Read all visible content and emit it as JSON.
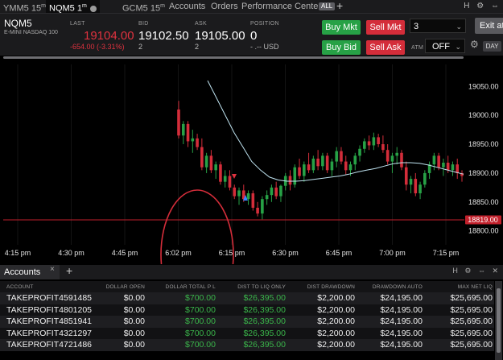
{
  "tabs": [
    {
      "label": "YMM5 15",
      "sup": "m",
      "active": false
    },
    {
      "label": "NQM5 1",
      "sup": "m",
      "active": true
    },
    {
      "label": "GCM5 15",
      "sup": "m",
      "active": false
    },
    {
      "label": "Accounts",
      "sup": "",
      "active": false
    },
    {
      "label": "Orders",
      "sup": "",
      "active": false
    },
    {
      "label": "Performance Center",
      "sup": "",
      "active": false
    }
  ],
  "all_badge": "ALL",
  "add_tab": "+",
  "window_icons": "H ⚙ ⇔",
  "quote": {
    "symbol": "NQM5",
    "description": "E-MINI NASDAQ 100",
    "last_label": "LAST",
    "last": "19104.00",
    "change": "-654.00 (-3.31%)",
    "bid_label": "BID",
    "bid": "19102.50",
    "bid_size": "2",
    "ask_label": "ASK",
    "ask": "19105.00",
    "ask_size": "2",
    "position_label": "POSITION",
    "position": "0",
    "position_sub": "- .-- USD"
  },
  "buttons": {
    "buy_mkt": "Buy Mkt",
    "sell_mkt": "Sell Mkt",
    "buy_bid": "Buy Bid",
    "sell_ask": "Sell Ask",
    "exit": "Exit at",
    "day": "DAY"
  },
  "quantity": "3",
  "atm_label": "ATM",
  "atm_value": "OFF",
  "colors": {
    "up": "#27a146",
    "down": "#d42d3a",
    "ma": "#bfe3f0",
    "price_line": "#c2202b",
    "highlight": "#d42d3a"
  },
  "chart_data": {
    "type": "candlestick",
    "y_ticks": [
      "19050.00",
      "19000.00",
      "18950.00",
      "18900.00",
      "18850.00",
      "18800.00"
    ],
    "ylim": [
      18787,
      19088
    ],
    "x_ticks": [
      "4:15 pm",
      "4:30 pm",
      "4:45 pm",
      "6:02 pm",
      "6:15 pm",
      "6:30 pm",
      "6:45 pm",
      "7:00 pm",
      "7:15 pm"
    ],
    "price_line": {
      "value": 18819.0,
      "label": "18819.00"
    },
    "candles": [
      [
        19010,
        19025,
        18960,
        18965
      ],
      [
        18965,
        18990,
        18950,
        18985
      ],
      [
        18985,
        18990,
        18945,
        18955
      ],
      [
        18955,
        18975,
        18935,
        18960
      ],
      [
        18960,
        18968,
        18940,
        18945
      ],
      [
        18945,
        18960,
        18905,
        18910
      ],
      [
        18910,
        18935,
        18900,
        18930
      ],
      [
        18930,
        18940,
        18900,
        18905
      ],
      [
        18905,
        18920,
        18890,
        18915
      ],
      [
        18915,
        18920,
        18880,
        18885
      ],
      [
        18885,
        18905,
        18875,
        18895
      ],
      [
        18895,
        18905,
        18870,
        18875
      ],
      [
        18875,
        18880,
        18855,
        18860
      ],
      [
        18860,
        18875,
        18845,
        18870
      ],
      [
        18870,
        18880,
        18850,
        18855
      ],
      [
        18855,
        18870,
        18845,
        18865
      ],
      [
        18865,
        18870,
        18835,
        18840
      ],
      [
        18840,
        18850,
        18825,
        18830
      ],
      [
        18830,
        18860,
        18820,
        18855
      ],
      [
        18855,
        18870,
        18845,
        18862
      ],
      [
        18862,
        18880,
        18850,
        18875
      ],
      [
        18875,
        18885,
        18855,
        18860
      ],
      [
        18860,
        18880,
        18850,
        18878
      ],
      [
        18878,
        18900,
        18870,
        18895
      ],
      [
        18895,
        18905,
        18870,
        18880
      ],
      [
        18880,
        18915,
        18875,
        18910
      ],
      [
        18910,
        18925,
        18890,
        18895
      ],
      [
        18895,
        18920,
        18885,
        18915
      ],
      [
        18915,
        18935,
        18900,
        18905
      ],
      [
        18905,
        18930,
        18900,
        18925
      ],
      [
        18925,
        18940,
        18905,
        18912
      ],
      [
        18912,
        18935,
        18905,
        18930
      ],
      [
        18930,
        18935,
        18900,
        18905
      ],
      [
        18905,
        18925,
        18895,
        18920
      ],
      [
        18920,
        18945,
        18910,
        18938
      ],
      [
        18938,
        18945,
        18915,
        18920
      ],
      [
        18920,
        18930,
        18898,
        18905
      ],
      [
        18905,
        18920,
        18895,
        18915
      ],
      [
        18915,
        18935,
        18905,
        18930
      ],
      [
        18930,
        18948,
        18920,
        18942
      ],
      [
        18942,
        18960,
        18935,
        18955
      ],
      [
        18955,
        18965,
        18940,
        18948
      ],
      [
        18948,
        18970,
        18940,
        18962
      ],
      [
        18962,
        18968,
        18945,
        18950
      ],
      [
        18950,
        18965,
        18935,
        18940
      ],
      [
        18940,
        18950,
        18915,
        18920
      ],
      [
        18920,
        18935,
        18900,
        18930
      ],
      [
        18930,
        18945,
        18915,
        18935
      ],
      [
        18935,
        18940,
        18905,
        18910
      ],
      [
        18910,
        18920,
        18870,
        18880
      ],
      [
        18880,
        18895,
        18865,
        18890
      ],
      [
        18890,
        18900,
        18860,
        18865
      ],
      [
        18865,
        18885,
        18855,
        18880
      ],
      [
        18880,
        18905,
        18875,
        18900
      ],
      [
        18900,
        18920,
        18890,
        18915
      ],
      [
        18915,
        18935,
        18905,
        18930
      ],
      [
        18930,
        18935,
        18905,
        18910
      ],
      [
        18910,
        18925,
        18895,
        18918
      ],
      [
        18918,
        18930,
        18900,
        18905
      ],
      [
        18905,
        18920,
        18895,
        18915
      ],
      [
        18915,
        18925,
        18890,
        18900
      ],
      [
        18900,
        18905,
        18885,
        18895
      ]
    ],
    "moving_average": [
      19060,
      19030,
      19000,
      18970,
      18945,
      18920,
      18905,
      18893,
      18888,
      18886,
      18886,
      18887,
      18889,
      18891,
      18893,
      18895,
      18898,
      18902,
      18905,
      18908,
      18912,
      18916,
      18918,
      18918,
      18917,
      18914,
      18910,
      18906,
      18902,
      18898
    ]
  },
  "accounts_panel": {
    "tab_label": "Accounts",
    "close": "×",
    "add": "+",
    "icons": "H ⚙ ⇔ ✕",
    "columns": [
      "ACCOUNT",
      "DOLLAR OPEN",
      "DOLLAR TOTAL P L",
      "DIST TO LIQ ONLY",
      "DIST DRAWDOWN",
      "DRAWDOWN AUTO",
      "MAX NET LIQ"
    ],
    "rows": [
      [
        "TAKEPROFIT4591485",
        "$0.00",
        "$700.00",
        "$26,395.00",
        "$2,200.00",
        "$24,195.00",
        "$25,695.00"
      ],
      [
        "TAKEPROFIT4801205",
        "$0.00",
        "$700.00",
        "$26,395.00",
        "$2,200.00",
        "$24,195.00",
        "$25,695.00"
      ],
      [
        "TAKEPROFIT4851941",
        "$0.00",
        "$700.00",
        "$26,395.00",
        "$2,200.00",
        "$24,195.00",
        "$25,695.00"
      ],
      [
        "TAKEPROFIT4321297",
        "$0.00",
        "$700.00",
        "$26,395.00",
        "$2,200.00",
        "$24,195.00",
        "$25,695.00"
      ],
      [
        "TAKEPROFIT4721486",
        "$0.00",
        "$700.00",
        "$26,395.00",
        "$2,200.00",
        "$24,195.00",
        "$25,695.00"
      ]
    ]
  }
}
